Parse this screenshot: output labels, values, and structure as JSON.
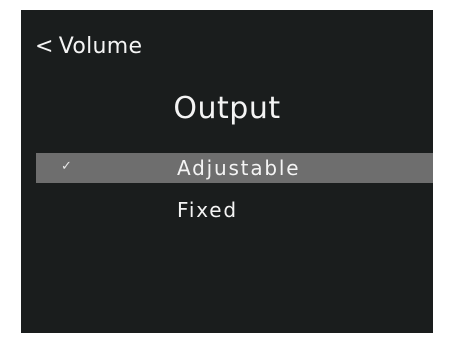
{
  "header": {
    "back_chevron": "<",
    "back_label": "Volume"
  },
  "title": "Output",
  "options": [
    {
      "label": "Adjustable",
      "selected": true,
      "check": "✓"
    },
    {
      "label": "Fixed",
      "selected": false,
      "check": ""
    }
  ],
  "colors": {
    "background": "#1a1d1d",
    "selection": "#6e6e6e",
    "text": "#f4f4f4"
  }
}
